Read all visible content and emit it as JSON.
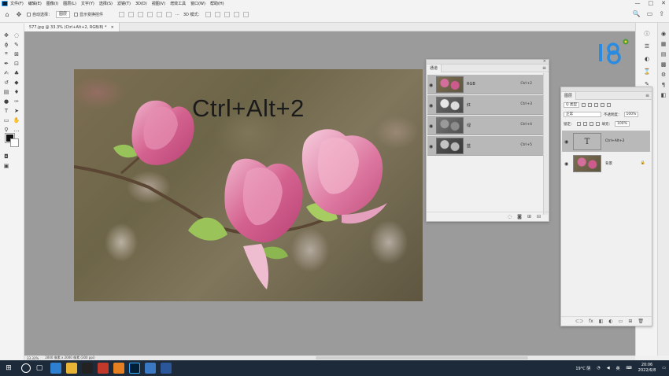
{
  "menubar": {
    "items": [
      "文件(F)",
      "编辑(E)",
      "图像(I)",
      "图层(L)",
      "文字(Y)",
      "选择(S)",
      "滤镜(T)",
      "3D(D)",
      "视图(V)",
      "增效工具",
      "窗口(W)",
      "帮助(H)"
    ],
    "window_controls": [
      "—",
      "□",
      "✕"
    ]
  },
  "options_bar": {
    "home_icon": "⌂",
    "move_icon": "✥",
    "auto_select_label": "自动选择：",
    "auto_select_value": "图层",
    "show_transform_label": "显示变换控件",
    "more_label": "···",
    "mode_3d_label": "3D 模式：",
    "right_icons": [
      "🔍",
      "▭",
      "⇪"
    ]
  },
  "document": {
    "tab_title": "577.jpg @ 33.3% (Ctrl+Alt+2, RGB/8) *",
    "tab_close": "×",
    "canvas_text": "Ctrl+Alt+2"
  },
  "channels_panel": {
    "title": "通道",
    "close": "×",
    "menu": "≡",
    "rows": [
      {
        "name": "RGB",
        "shortcut": "Ctrl+2"
      },
      {
        "name": "红",
        "shortcut": "Ctrl+3"
      },
      {
        "name": "绿",
        "shortcut": "Ctrl+4"
      },
      {
        "name": "蓝",
        "shortcut": "Ctrl+5"
      }
    ],
    "footer_icons": [
      "◌",
      "◙",
      "⊞",
      "⊟"
    ]
  },
  "layers_panel": {
    "title": "图层",
    "kind_label": "Q 类型",
    "blend_mode": "正常",
    "opacity_label": "不透明度：",
    "opacity_value": "100%",
    "lock_label": "锁定：",
    "fill_label": "填充：",
    "fill_value": "100%",
    "layers": [
      {
        "name": "Ctrl+Alt+2",
        "thumb_glyph": "T"
      },
      {
        "name": "背景",
        "lock": "🔒"
      }
    ],
    "footer_icons": [
      "⊂⊃",
      "fx",
      "◧",
      "◐",
      "▭",
      "⊞",
      "🗑"
    ]
  },
  "statusbar": {
    "zoom": "33.33%",
    "doc_info": "2000 像素 x 2000 像素 (300 ppi)"
  },
  "taskbar": {
    "weather": "19°C 阴",
    "lang": "英",
    "time": "20:06",
    "date": "2022/6/8"
  },
  "colors": {
    "canvas_bg": "#9b9b9b",
    "taskbar_bg": "#1c2a3a",
    "accent_ps": "#31a8ff"
  }
}
